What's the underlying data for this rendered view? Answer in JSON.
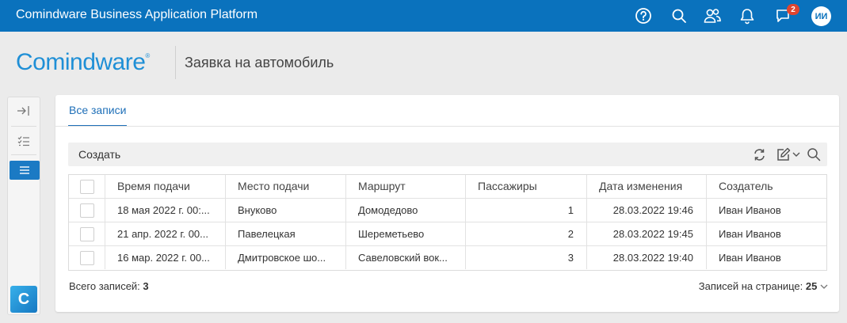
{
  "topbar": {
    "title": "Comindware Business Application Platform",
    "icons": [
      "help-icon",
      "search-icon",
      "users-icon",
      "bell-icon",
      "chat-icon"
    ],
    "notification_count": "2",
    "user_initials": "ИИ",
    "accent_color": "#0a72bd"
  },
  "header": {
    "logo_text": "Comindware",
    "logo_mark": "®",
    "page_title": "Заявка на автомобиль"
  },
  "rail": {
    "items": [
      "collapse-icon",
      "checklist-icon",
      "list-icon"
    ],
    "active_item": "list-icon",
    "app_logo": "C"
  },
  "tabs": [
    {
      "label": "Все записи",
      "active": true
    }
  ],
  "toolbar": {
    "create_label": "Создать",
    "icons": [
      "refresh-icon",
      "edit-icon",
      "chevron-down-icon",
      "search-icon"
    ]
  },
  "table": {
    "columns": [
      "Время подачи",
      "Место подачи",
      "Маршрут",
      "Пассажиры",
      "Дата изменения",
      "Создатель"
    ],
    "rows": [
      [
        "18 мая 2022 г. 00:...",
        "Внуково",
        "Домодедово",
        "1",
        "28.03.2022 19:46",
        "Иван Иванов"
      ],
      [
        "21 апр. 2022 г. 00...",
        "Павелецкая",
        "Шереметьево",
        "2",
        "28.03.2022 19:45",
        "Иван Иванов"
      ],
      [
        "16 мар. 2022 г. 00...",
        "Дмитровское шо...",
        "Савеловский вок...",
        "3",
        "28.03.2022 19:40",
        "Иван Иванов"
      ]
    ]
  },
  "footer": {
    "total_label": "Всего записей:",
    "total_value": "3",
    "page_size_label": "Записей на странице:",
    "page_size_value": "25"
  }
}
